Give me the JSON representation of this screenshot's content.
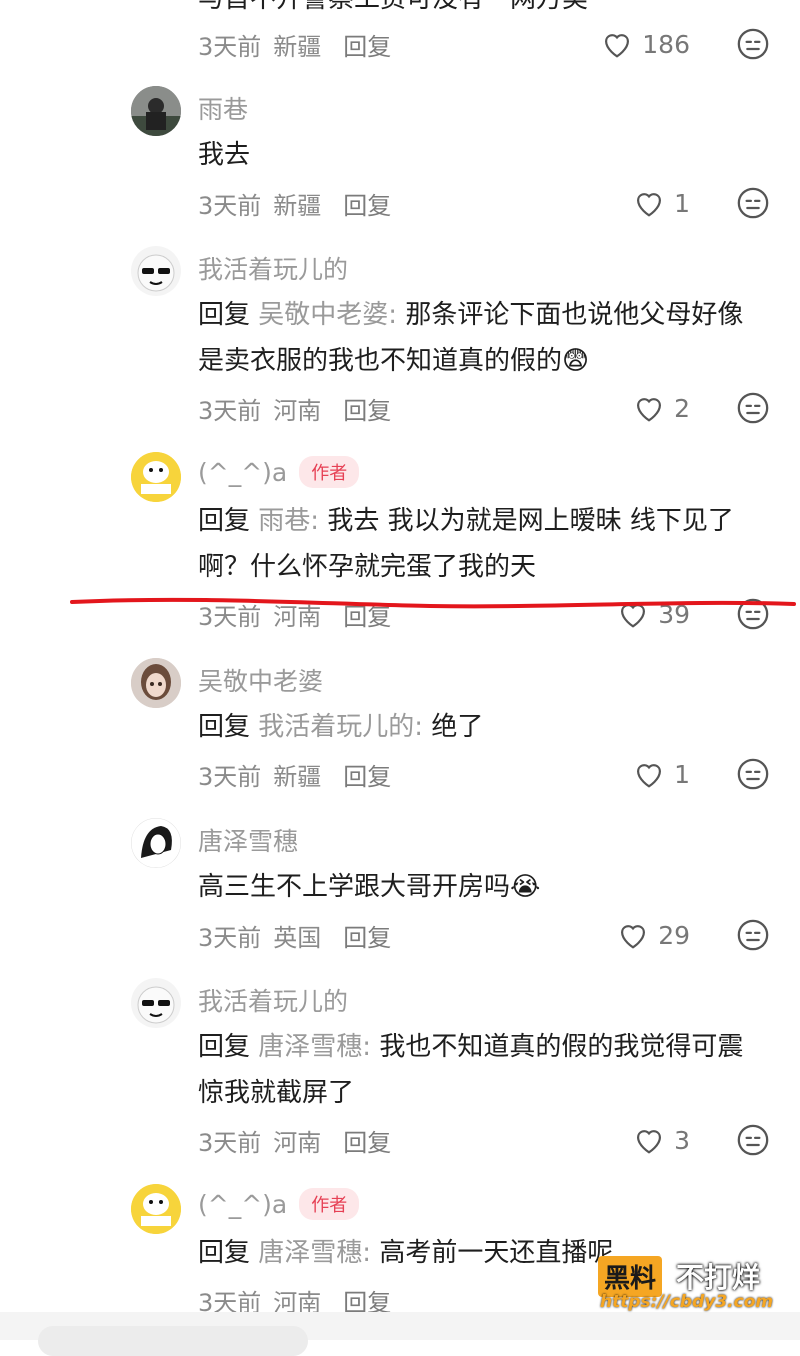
{
  "top_partial": {
    "cut_text": "与首不开警察工资可没有一网万类",
    "time": "3天前",
    "location": "新疆",
    "reply_label": "回复",
    "likes": "186"
  },
  "comments": [
    {
      "username": "雨巷",
      "author_badge": "",
      "reply_prefix": "",
      "reply_target": "",
      "text": "我去",
      "time": "3天前",
      "location": "新疆",
      "reply_label": "回复",
      "likes": "1"
    },
    {
      "username": "我活着玩儿的",
      "author_badge": "",
      "reply_prefix": "回复",
      "reply_target": "吴敬中老婆:",
      "text": "那条评论下面也说他父母好像是卖衣服的我也不知道真的假的",
      "emoji": "😨",
      "time": "3天前",
      "location": "河南",
      "reply_label": "回复",
      "likes": "2"
    },
    {
      "username": "(^_^)a",
      "author_badge": "作者",
      "reply_prefix": "回复",
      "reply_target": "雨巷:",
      "text": "我去 我以为就是网上暧昧 线下见了啊？什么怀孕就完蛋了我的天",
      "time": "3天前",
      "location": "河南",
      "reply_label": "回复",
      "likes": "39"
    },
    {
      "username": "吴敬中老婆",
      "author_badge": "",
      "reply_prefix": "回复",
      "reply_target": "我活着玩儿的:",
      "text": "绝了",
      "time": "3天前",
      "location": "新疆",
      "reply_label": "回复",
      "likes": "1"
    },
    {
      "username": "唐泽雪穗",
      "author_badge": "",
      "reply_prefix": "",
      "reply_target": "",
      "text": "高三生不上学跟大哥开房吗",
      "emoji": "😭",
      "time": "3天前",
      "location": "英国",
      "reply_label": "回复",
      "likes": "29"
    },
    {
      "username": "我活着玩儿的",
      "author_badge": "",
      "reply_prefix": "回复",
      "reply_target": "唐泽雪穗:",
      "text": "我也不知道真的假的我觉得可震惊我就截屏了",
      "time": "3天前",
      "location": "河南",
      "reply_label": "回复",
      "likes": "3"
    },
    {
      "username": "(^_^)a",
      "author_badge": "作者",
      "reply_prefix": "回复",
      "reply_target": "唐泽雪穗:",
      "text": "高考前一天还直播呢",
      "time": "3天前",
      "location": "河南",
      "reply_label": "回复",
      "likes": ""
    }
  ],
  "watermark": {
    "badge": "黑料",
    "text": "不打烊",
    "url": "https://cbdy3.com"
  },
  "colors": {
    "annotation_red": "#e3161c",
    "author_badge_bg": "#fde7e9",
    "author_badge_text": "#e64155"
  },
  "icons": {
    "like": "heart-outline-icon",
    "emoji": "meh-face-icon"
  }
}
